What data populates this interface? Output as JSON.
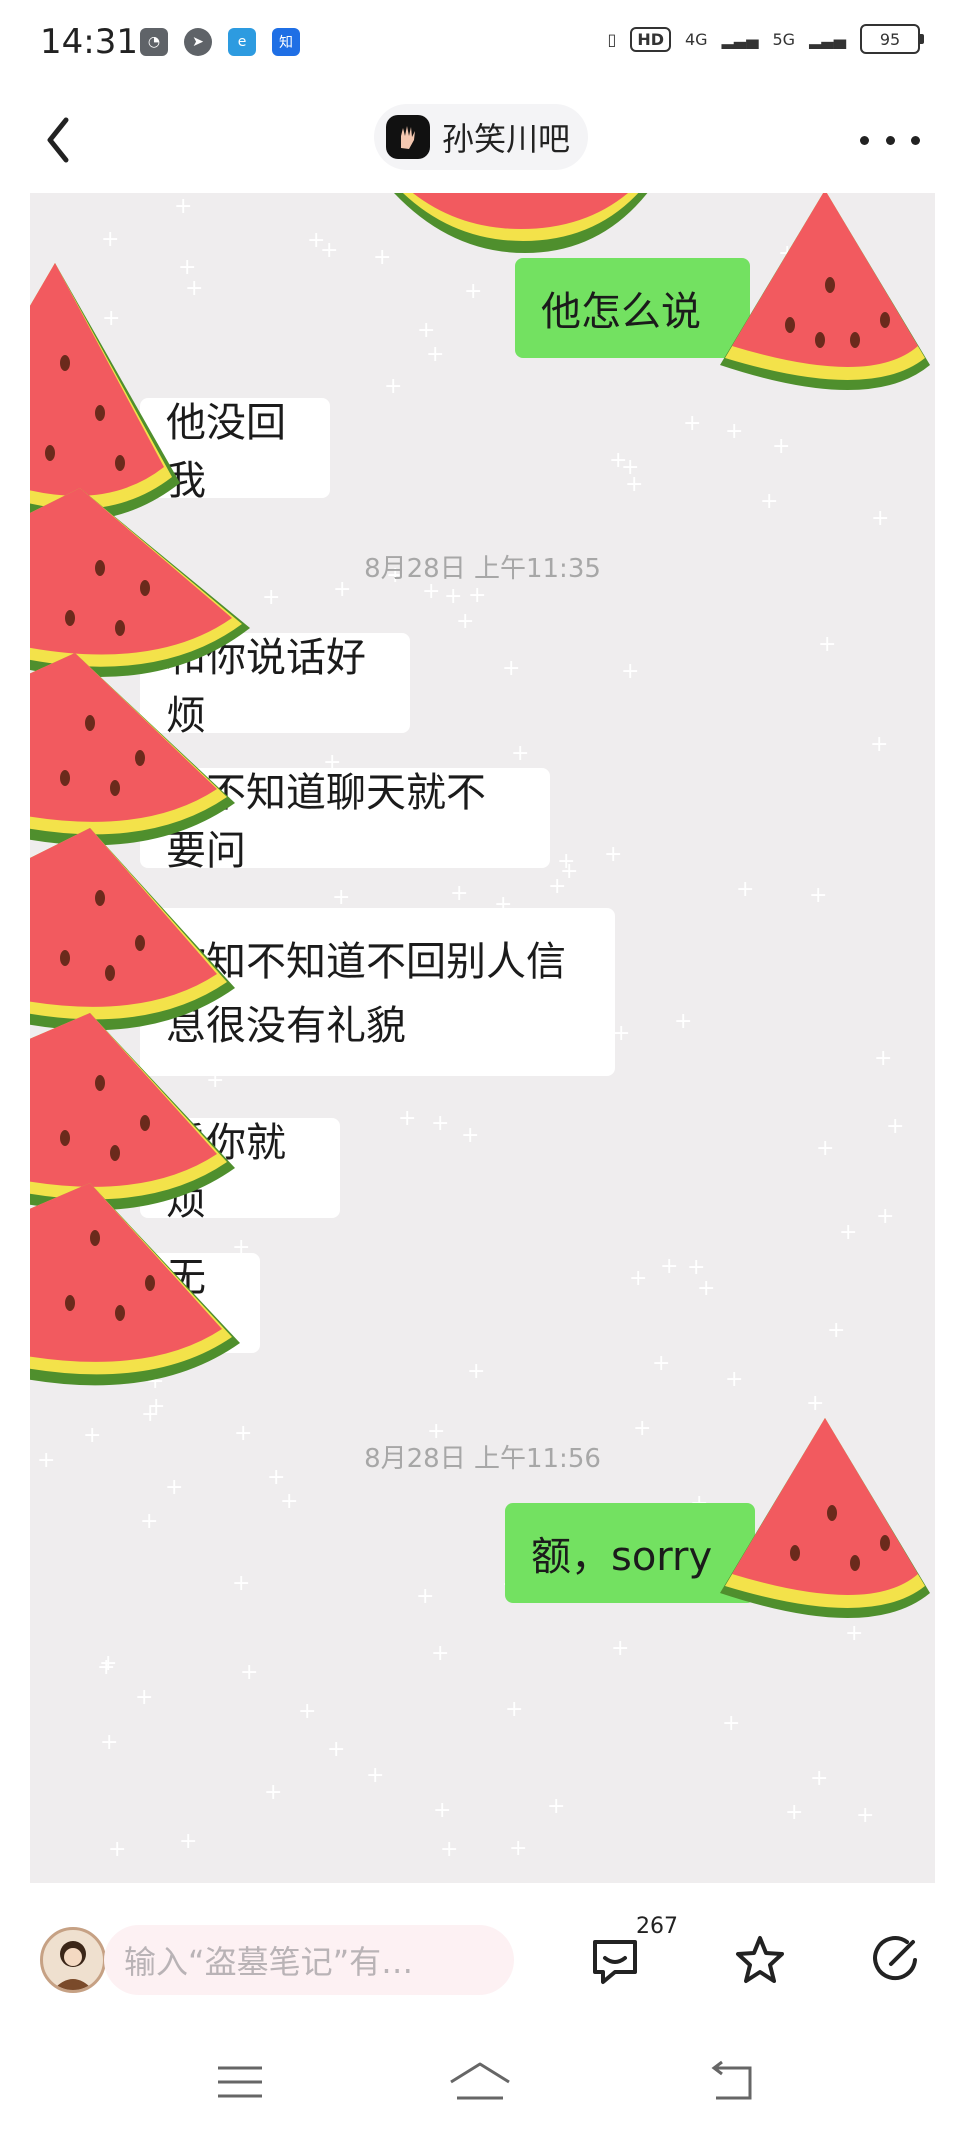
{
  "status_bar": {
    "time": "14:31",
    "hd_label": "HD",
    "net1": "4G",
    "net2": "5G",
    "battery": "95"
  },
  "header": {
    "title": "孙笑川吧",
    "back_icon": "chevron-left-icon",
    "more_icon": "more-dots-icon"
  },
  "chat": {
    "messages": [
      {
        "side": "out",
        "text": "他怎么说"
      },
      {
        "side": "in",
        "text": "他没回我"
      },
      {
        "timestamp": "8月28日 上午11:35"
      },
      {
        "side": "in",
        "text": "和你说话好烦"
      },
      {
        "side": "in",
        "text": "你不知道聊天就不要问"
      },
      {
        "side": "in",
        "text": "你知不知道不回别人信息很没有礼貌"
      },
      {
        "side": "in",
        "text": "看你就烦"
      },
      {
        "side": "in",
        "text": "无语"
      },
      {
        "timestamp": "8月28日 上午11:56"
      },
      {
        "side": "out",
        "text": "额，sorry"
      }
    ]
  },
  "input_bar": {
    "placeholder": "输入“盗墓笔记”有…",
    "comment_count": "267",
    "comment_icon": "comment-icon",
    "star_icon": "star-icon",
    "share_icon": "share-icon"
  },
  "system_nav": {
    "menu_icon": "menu-icon",
    "home_icon": "home-icon",
    "back_icon": "back-icon"
  },
  "colors": {
    "out_bubble": "#73e161",
    "in_bubble": "#ffffff",
    "chat_bg": "#efedee",
    "melon_flesh": "#f25a5f",
    "melon_rind_yellow": "#f3e24a",
    "melon_rind_green": "#4f8f2d"
  }
}
